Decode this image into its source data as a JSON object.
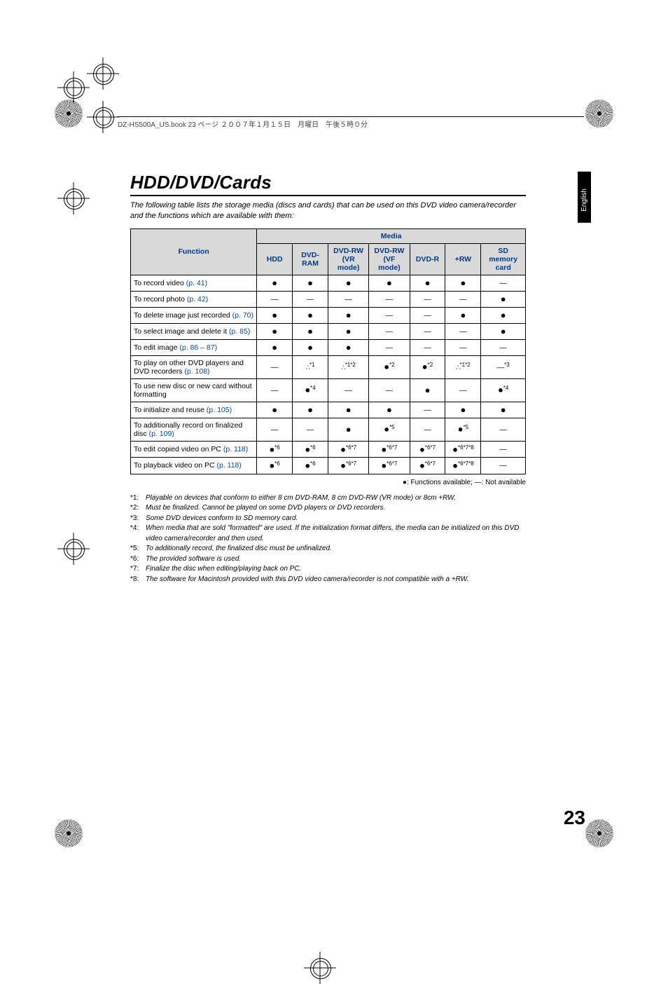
{
  "header_text": "DZ-HS500A_US.book  23 ページ  ２００７年１月１５日　月曜日　午後５時０分",
  "side_tab": "English",
  "title": "HDD/DVD/Cards",
  "intro": "The following table lists the storage media (discs and cards) that can be used on this DVD video camera/recorder and the functions which are available with them:",
  "page_number": "23",
  "legend": "●: Functions available; —: Not available",
  "table": {
    "media_header": "Media",
    "function_header": "Function",
    "columns": [
      "HDD",
      "DVD-RAM",
      "DVD-RW (VR mode)",
      "DVD-RW (VF mode)",
      "DVD-R",
      "+RW",
      "SD memory card"
    ],
    "rows": [
      {
        "label": "To record video ",
        "link": "(p. 41)",
        "cells": [
          "●",
          "●",
          "●",
          "●",
          "●",
          "●",
          "—"
        ]
      },
      {
        "label": "To record photo ",
        "link": "(p. 42)",
        "cells": [
          "—",
          "—",
          "—",
          "—",
          "—",
          "—",
          "●"
        ]
      },
      {
        "label": "To delete image just recorded ",
        "link": "(p. 70)",
        "cells": [
          "●",
          "●",
          "●",
          "—",
          "—",
          "●",
          "●"
        ]
      },
      {
        "label": "To select image and delete it ",
        "link": "(p. 85)",
        "cells": [
          "●",
          "●",
          "●",
          "—",
          "—",
          "—",
          "●"
        ]
      },
      {
        "label": "To edit image ",
        "link": "(p. 86 – 87)",
        "cells": [
          "●",
          "●",
          "●",
          "—",
          "—",
          "—",
          "—"
        ]
      },
      {
        "label": "To play on other DVD players and DVD recorders ",
        "link": "(p. 108)",
        "cells": [
          "—",
          "∴*1",
          "∴*1*2",
          "●*2",
          "●*2",
          "∴*1*2",
          "—*3"
        ]
      },
      {
        "label": "To use new disc or new card without formatting",
        "link": "",
        "cells": [
          "—",
          "●*4",
          "—",
          "—",
          "●",
          "—",
          "●*4"
        ]
      },
      {
        "label": "To initialize and reuse ",
        "link": "(p. 105)",
        "cells": [
          "●",
          "●",
          "●",
          "●",
          "—",
          "●",
          "●"
        ]
      },
      {
        "label": "To additionally record on finalized disc ",
        "link": "(p. 109)",
        "cells": [
          "—",
          "—",
          "●",
          "●*5",
          "—",
          "●*5",
          "—"
        ]
      },
      {
        "label": "To edit copied video on PC ",
        "link": "(p. 118)",
        "cells": [
          "●*6",
          "●*6",
          "●*6*7",
          "●*6*7",
          "●*6*7",
          "●*6*7*8",
          "—"
        ]
      },
      {
        "label": "To playback video on PC ",
        "link": "(p. 118)",
        "cells": [
          "●*6",
          "●*6",
          "●*6*7",
          "●*6*7",
          "●*6*7",
          "●*6*7*8",
          "—"
        ]
      }
    ]
  },
  "footnotes": [
    {
      "key": "*1:",
      "text": "Playable on devices that conform to either 8 cm DVD-RAM, 8 cm DVD-RW (VR mode) or 8cm +RW."
    },
    {
      "key": "*2:",
      "text": "Must be finalized. Cannot be played on some DVD players or DVD recorders."
    },
    {
      "key": "*3:",
      "text": "Some DVD devices conform to SD memory card."
    },
    {
      "key": "*4:",
      "text": "When media that are sold \"formatted\" are used. If the initialization format differs, the media can be initialized on this DVD video camera/recorder and then used."
    },
    {
      "key": "*5:",
      "text": "To additionally record, the finalized disc must be unfinalized."
    },
    {
      "key": "*6:",
      "text": "The provided software is used."
    },
    {
      "key": "*7:",
      "text": "Finalize the disc when editing/playing back on PC."
    },
    {
      "key": "*8:",
      "text": "The software for Macintosh provided with this DVD video camera/recorder is not compatible with a +RW."
    }
  ]
}
